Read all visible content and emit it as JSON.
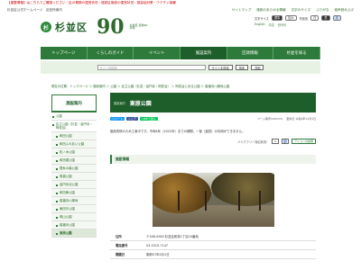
{
  "alert": "【重要情報】はこちらでご確認ください｜区の業務の運営状況・施設区施設の運営状況・感染症対策・ワクチン接種",
  "topbar": {
    "left": "杉並区公式ホームページ　区役所案内",
    "links": [
      "サイトマップ",
      "施設のあらゆる情報",
      "文字のサイズ",
      "ふりがな",
      "音声読み上げ"
    ]
  },
  "logo": {
    "mark": "杉",
    "name": "杉並区",
    "anniv": "90",
    "anniv_sub": "杉並区 区制90周年"
  },
  "util": {
    "font_label": "文字サイズ",
    "font_opts": [
      "標準",
      "拡大"
    ],
    "color_label": "背景色",
    "color_opts": [
      "白",
      "黒",
      "青"
    ],
    "langs": [
      "English",
      "中文",
      "한국어"
    ]
  },
  "nav": [
    "トップページ",
    "くらしのガイド",
    "イベント",
    "施設案内",
    "区政情報",
    "杉並を知る"
  ],
  "search": {
    "placeholder": "サイト内検索",
    "scope": "サイトを検索",
    "button": "検索",
    "detail": "詳細"
  },
  "breadcrumb": "現在の位置：トップページ ＞ 施設案内 ＞ 公園 ＞ 区立公園（杉並・高円寺・阿佐谷） ＞ 阿佐谷にある公園 ＞ 善福寺川緑地公園",
  "sidebar": {
    "head": "施設案内",
    "items": [
      {
        "label": "公園",
        "type": "top"
      },
      {
        "label": "区立公園（杉並・高円寺・阿佐谷）",
        "type": "top"
      },
      {
        "label": "和田公園",
        "type": "sub"
      },
      {
        "label": "和田ふれあい公園",
        "type": "sub"
      },
      {
        "label": "松ノ木公園",
        "type": "sub"
      },
      {
        "label": "和田堀公園",
        "type": "sub"
      },
      {
        "label": "蚕糸の森公園",
        "type": "sub"
      },
      {
        "label": "馬橋公園",
        "type": "sub"
      },
      {
        "label": "高円寺北公園",
        "type": "sub"
      },
      {
        "label": "和田東公園",
        "type": "sub"
      },
      {
        "label": "善福寺川緑地",
        "type": "sub"
      },
      {
        "label": "東田中公園",
        "type": "sub"
      },
      {
        "label": "塚山公園",
        "type": "sub"
      },
      {
        "label": "善福寺公園",
        "type": "sub"
      },
      {
        "label": "東原公園",
        "type": "sub current"
      }
    ]
  },
  "main": {
    "category": "施設案内",
    "title": "東原公園",
    "share": [
      "ツイート",
      "シェア",
      "LINEで送る"
    ],
    "page_id": "ページ番号1007072",
    "updated": "更新日 令和4年11月1日",
    "notice": "施設改修のため工事中です。令和4年（2022年）までの期間、一部（遊具）の利用ができません。",
    "accessibility_label": "バリアフリー対応状況：",
    "acc_badge": "アイコンの説明",
    "section": "施設情報",
    "table": [
      {
        "key": "住所",
        "value": "〒168-0063 杉並区和泉1丁目20番地"
      },
      {
        "key": "電話番号",
        "value": "03-3315-7147"
      },
      {
        "key": "開園日",
        "value": "昭和57年5月1日"
      }
    ]
  }
}
